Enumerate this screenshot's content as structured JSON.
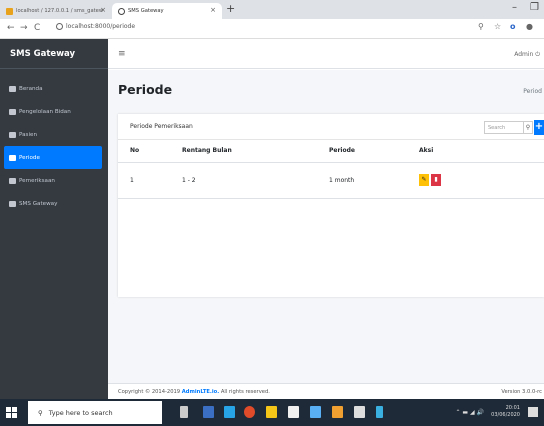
{
  "browser": {
    "tabs": [
      {
        "label": "localhost / 127.0.0.1 / sms_gatew"
      },
      {
        "label": "SMS Gateway"
      }
    ],
    "url": "localhost:8000/periode"
  },
  "sidebar": {
    "brand": "SMS Gateway",
    "items": [
      {
        "label": "Beranda"
      },
      {
        "label": "Pengelolaan Bidan"
      },
      {
        "label": "Pasien"
      },
      {
        "label": "Periode"
      },
      {
        "label": "Pemeriksaan"
      },
      {
        "label": "SMS Gateway"
      }
    ]
  },
  "header": {
    "menu_icon": "≡",
    "user": "Admin"
  },
  "main": {
    "title": "Periode",
    "breadcrumb": "Period",
    "card": {
      "title": "Periode Pemeriksaan",
      "search_placeholder": "Search",
      "columns": [
        "No",
        "Rentang Bulan",
        "Periode",
        "Aksi"
      ],
      "rows": [
        {
          "no": "1",
          "rentang": "1 - 2",
          "periode": "1 month"
        }
      ]
    }
  },
  "footer": {
    "copy_prefix": "Copyright © 2014-2019 ",
    "copy_brand": "AdminLTE.io.",
    "copy_suffix": " All rights reserved.",
    "version": "Version 3.0.0-rc"
  },
  "taskbar": {
    "search_placeholder": "Type here to search",
    "time": "20:01",
    "date": "03/06/2020"
  }
}
